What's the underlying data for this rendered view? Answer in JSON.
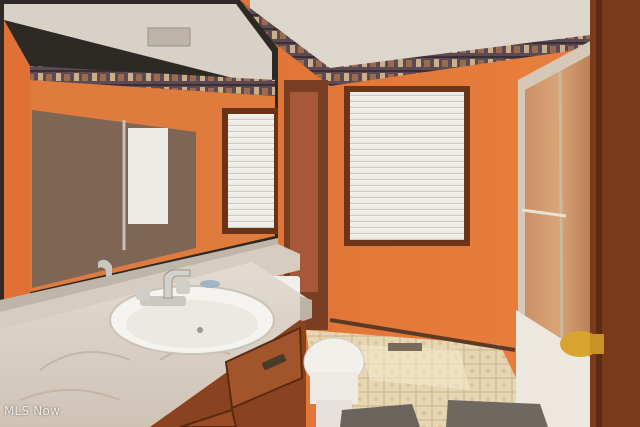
{
  "photo": {
    "subject": "bathroom",
    "watermark": "MLS Now",
    "colors": {
      "wall": "#e0763a",
      "ceiling": "#ddd6cc",
      "wallpaper_border": "#5a4a52",
      "wood": "#7a3a1c",
      "countertop": "#d9cfc4",
      "floor": "#e8d9b8"
    }
  }
}
